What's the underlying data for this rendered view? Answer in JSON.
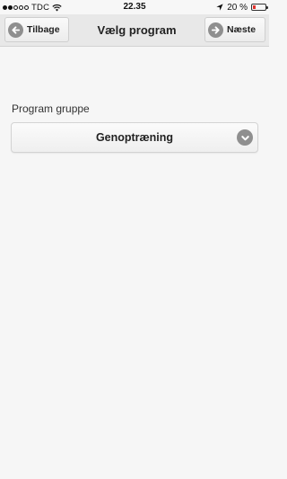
{
  "status_bar": {
    "carrier": "TDC",
    "time": "22.35",
    "battery_text": "20 %",
    "battery_level": 0.2,
    "battery_color": "#e0322d",
    "icons": [
      "signal-dots-icon",
      "wifi-icon",
      "location-arrow-icon",
      "battery-icon"
    ]
  },
  "nav": {
    "back_label": "Tilbage",
    "title": "Vælg program",
    "next_label": "Næste",
    "icons": [
      "arrow-left-icon",
      "arrow-right-icon"
    ]
  },
  "form": {
    "group_label": "Program gruppe",
    "selected_value": "Genoptræning",
    "icons": [
      "chevron-down-icon"
    ]
  }
}
